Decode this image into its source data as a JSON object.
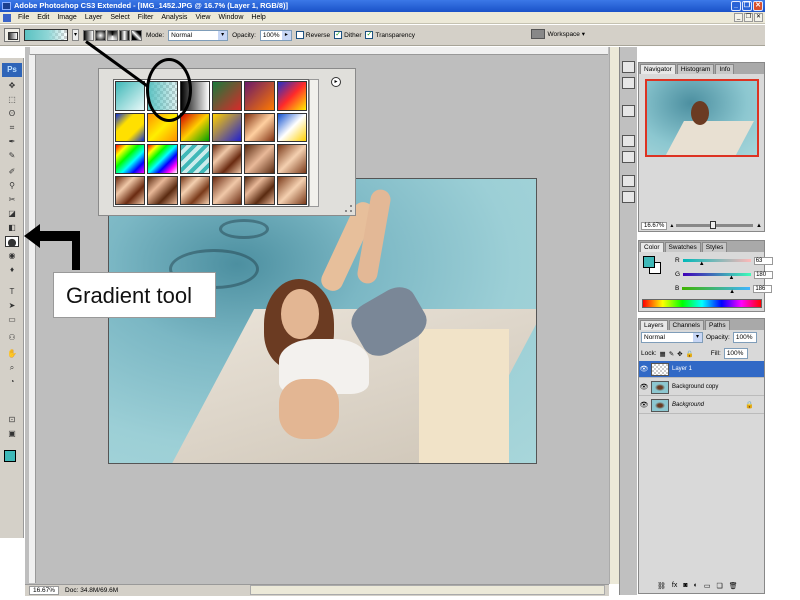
{
  "window": {
    "title": "Adobe Photoshop CS3 Extended - [IMG_1452.JPG @ 16.7% (Layer 1, RGB/8)]",
    "minimize": "_",
    "restore": "❐",
    "close": "✕"
  },
  "menu": {
    "items": [
      "File",
      "Edit",
      "Image",
      "Layer",
      "Select",
      "Filter",
      "Analysis",
      "View",
      "Window",
      "Help"
    ],
    "doc_controls": [
      "_",
      "❐",
      "✕"
    ]
  },
  "options": {
    "mode_label": "Mode:",
    "mode_value": "Normal",
    "opacity_label": "Opacity:",
    "opacity_value": "100%",
    "reverse_label": "Reverse",
    "dither_label": "Dither",
    "transparency_label": "Transparency",
    "workspace_label": "Workspace ▾",
    "dropdown_arrow": "▾",
    "check_mark": "✓",
    "opacity_arrow": "▸"
  },
  "toolbox": {
    "logo": "Ps",
    "glyphs": [
      "✥",
      "⬚",
      "ʘ",
      "⌗",
      "✒",
      "✎",
      "✐",
      "⚲",
      "✂",
      "◪",
      "◧",
      "⬤",
      "◉",
      "♦",
      "T",
      "➤",
      "▭",
      "✋",
      "⌕",
      "⚇",
      "◔",
      "⊡",
      "▣"
    ]
  },
  "gradient_picker": {
    "menu_icon": "▸",
    "swatches": [
      "linear-gradient(135deg,#3fb8b8,#e9f9f9)",
      "linear-gradient(90deg,#5bc2c2,rgba(91,194,194,0.2)), repeating-conic-gradient(#ccc 0 25%,#fff 0 50%) 0 0/6px 6px",
      "linear-gradient(90deg,#000,#fff)",
      "linear-gradient(135deg,#1a7a3a,#d82a2a)",
      "linear-gradient(135deg,#6a1a6a,#ff7a00)",
      "linear-gradient(135deg,#2230c8,#ff2a2a,#ffee00)",
      "linear-gradient(135deg,#1030d0,#ffe000,#ffe000,#1030d0)",
      "linear-gradient(135deg,#ff9000,#ffee00,#ff9000)",
      "linear-gradient(135deg,#d00000,#ffd000,#00a000)",
      "linear-gradient(135deg,#ffd000,#2020d0)",
      "linear-gradient(135deg,#803010,#ffd0a0,#803010)",
      "linear-gradient(135deg,#1050d0,#ffffff,#ffd000)",
      "linear-gradient(135deg,#f00,#ff0,#0f0,#0ff,#00f,#f0f)",
      "linear-gradient(135deg,#f00,#ff0,#0f0,#0ff,#00f,#f0f,#fff)",
      "repeating-linear-gradient(135deg,#3fb8b8 0 4px,#cdecec 4px 8px)",
      "linear-gradient(135deg,#6a2a10,#f0c8a8,#6a2a10,#f0c8a8)",
      "linear-gradient(135deg,#5a2a10,#e8b898,#5a2a10)",
      "linear-gradient(135deg,#7a3a1a,#f4d0b0,#7a3a1a)",
      "linear-gradient(135deg,#6a2a10,#f0c8a8,#6a2a10,#f0c8a8)",
      "linear-gradient(135deg,#5a2a10,#e8b898,#5a2a10,#e8b898)",
      "linear-gradient(135deg,#7a3a1a,#f4d0b0,#7a3a1a,#f4d0b0)",
      "linear-gradient(135deg,#6a2a10,#f0c8a8,#6a2a10)",
      "linear-gradient(135deg,#5a2a10,#e8b898,#5a2a10,#e8b898)",
      "linear-gradient(135deg,#7a3a1a,#f4d0b0,#7a3a1a)"
    ]
  },
  "annotation": {
    "label": "Gradient tool"
  },
  "status": {
    "zoom": "16.67%",
    "doc": "Doc: 34.8M/69.6M"
  },
  "navigator": {
    "tabs": [
      "Navigator",
      "Histogram",
      "Info"
    ],
    "zoom": "16.67%"
  },
  "color_panel": {
    "tabs": [
      "Color",
      "Swatches",
      "Styles"
    ],
    "channels": [
      {
        "label": "R",
        "value": "63",
        "gradient": "linear-gradient(90deg,#00b8b8,#ffb8b8)",
        "pos": 0.25
      },
      {
        "label": "G",
        "value": "180",
        "gradient": "linear-gradient(90deg,#3f00b8,#3fffb8)",
        "pos": 0.71
      },
      {
        "label": "B",
        "value": "186",
        "gradient": "linear-gradient(90deg,#3fb400,#3fb4ff)",
        "pos": 0.73
      }
    ]
  },
  "layers": {
    "tabs": [
      "Layers",
      "Channels",
      "Paths"
    ],
    "blend": "Normal",
    "opacity_label": "Opacity:",
    "opacity": "100%",
    "lock_label": "Lock:",
    "fill_label": "Fill:",
    "fill": "100%",
    "rows": [
      {
        "name": "Layer 1",
        "thumb": "trans",
        "selected": true
      },
      {
        "name": "Background copy",
        "thumb": "img",
        "selected": false
      },
      {
        "name": "Background",
        "thumb": "img",
        "selected": false,
        "locked": true
      }
    ],
    "footer_icons": [
      "⛓",
      "fx",
      "◙",
      "◐",
      "▭",
      "❏",
      "🗑"
    ]
  }
}
